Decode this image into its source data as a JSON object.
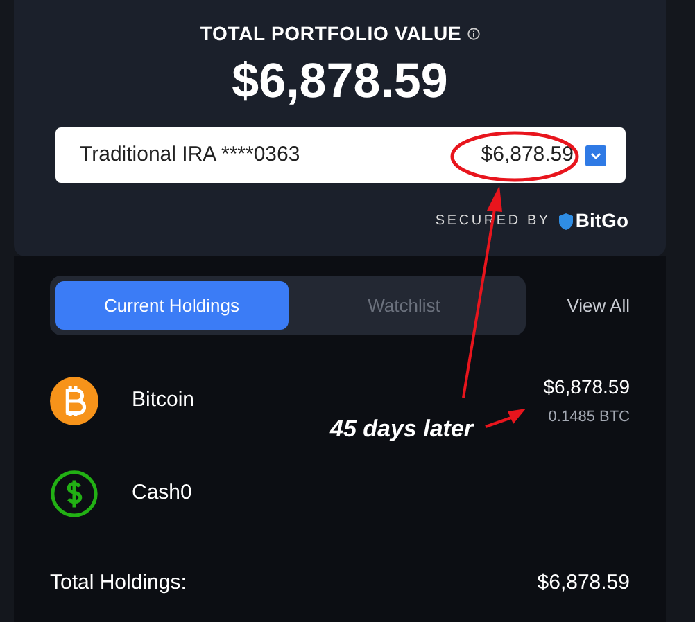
{
  "portfolio": {
    "title": "TOTAL PORTFOLIO VALUE",
    "value": "$6,878.59"
  },
  "account_select": {
    "label": "Traditional IRA ****0363",
    "value": "$6,878.59"
  },
  "security": {
    "label": "SECURED BY",
    "brand": "BitGo"
  },
  "tabs": [
    {
      "label": "Current Holdings",
      "selected": true
    },
    {
      "label": "Watchlist",
      "selected": false
    }
  ],
  "view_all": "View All",
  "holdings": [
    {
      "kind": "bitcoin",
      "name": "Bitcoin",
      "value": "$6,878.59",
      "amount": "0.1485 BTC"
    },
    {
      "kind": "cash",
      "name": "Cash0"
    }
  ],
  "total": {
    "label": "Total Holdings:",
    "value": "$6,878.59"
  },
  "annotation": {
    "text": "45 days later"
  }
}
